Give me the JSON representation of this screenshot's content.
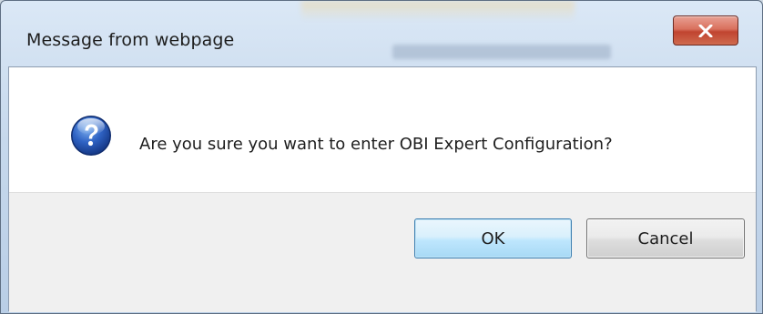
{
  "dialog": {
    "title": "Message from webpage",
    "message": "Are you sure you want to enter OBI Expert Configuration?",
    "icon": "question-icon",
    "buttons": {
      "ok_label": "OK",
      "cancel_label": "Cancel"
    },
    "close_icon": "close-icon"
  },
  "colors": {
    "close_button": "#c9503c",
    "ok_border": "#3c7fb1",
    "button_bar": "#f0f0f0"
  }
}
